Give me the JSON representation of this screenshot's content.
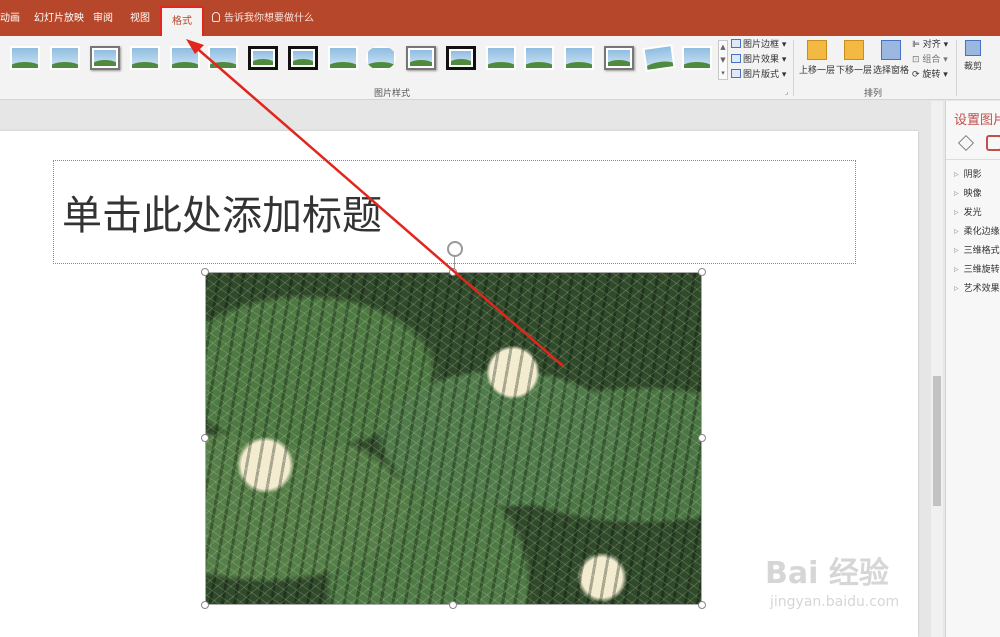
{
  "tabs": [
    {
      "label": "动画",
      "active": false
    },
    {
      "label": "幻灯片放映",
      "active": false
    },
    {
      "label": "审阅",
      "active": false
    },
    {
      "label": "视图",
      "active": false
    },
    {
      "label": "格式",
      "active": true
    }
  ],
  "tell_me": "告诉我你想要做什么",
  "ribbon": {
    "picture_styles": {
      "label": "图片样式",
      "border": "图片边框",
      "effects": "图片效果",
      "layout": "图片版式"
    },
    "arrange": {
      "label": "排列",
      "bring_forward": "上移一层",
      "send_backward": "下移一层",
      "selection_pane": "选择窗格",
      "align": "对齐",
      "group": "组合",
      "rotate": "旋转"
    },
    "size": {
      "crop": "裁剪"
    }
  },
  "slide": {
    "title_placeholder": "单击此处添加标题"
  },
  "format_panel": {
    "title": "设置图片",
    "items": [
      "阴影",
      "映像",
      "发光",
      "柔化边缘",
      "三维格式",
      "三维旋转",
      "艺术效果"
    ]
  },
  "watermark": {
    "brand": "Bai 经验",
    "url": "jingyan.baidu.com"
  },
  "colors": {
    "accent": "#b7472a",
    "annotation": "#e1261c"
  }
}
